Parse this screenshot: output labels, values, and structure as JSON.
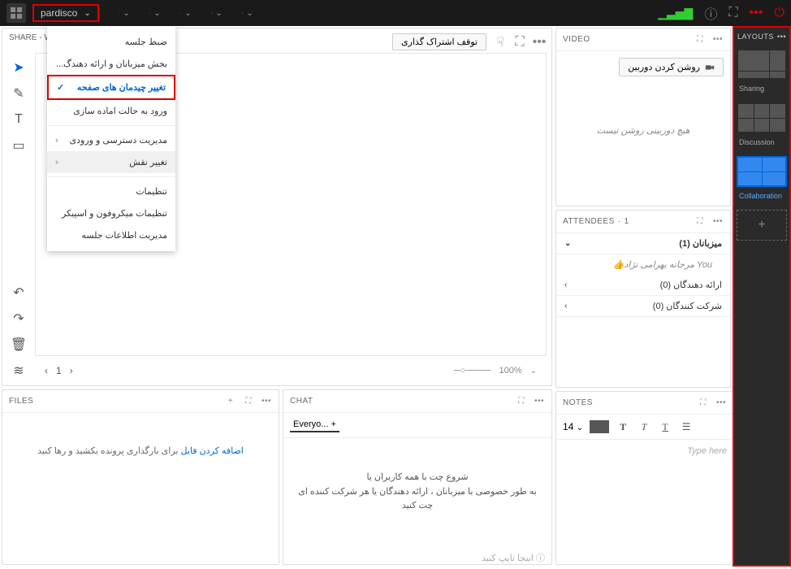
{
  "topbar": {
    "meeting_name": "pardisco",
    "icons": [
      "grid",
      "speaker",
      "mic",
      "camera",
      "thumbs-up"
    ]
  },
  "menu": {
    "items": [
      {
        "label": "ضبط جلسه"
      },
      {
        "label": "بخش میزبانان و ارائه دهندگ..."
      },
      {
        "label": "تغییر چیدمان های صفحه",
        "selected": true
      },
      {
        "label": "ورود به حالت اماده سازی"
      },
      {
        "label": "مدیریت دسترسی و ورودی",
        "submenu": true
      },
      {
        "label": "تغییر نقش",
        "submenu": true,
        "hover": true
      },
      {
        "label": "تنظیمات"
      },
      {
        "label": "تنظیمات میکروفون و اسپیکر"
      },
      {
        "label": "مدیریت اطلاعات جلسه"
      }
    ]
  },
  "share": {
    "title": "SHARE - W",
    "stop_button": "توقف اشتراک گذاری",
    "page": "1",
    "zoom": "100%"
  },
  "video": {
    "title": "VIDEO",
    "camera_btn": "روشن کردن دوربین",
    "empty": "هیچ دوربینی روشن نیست"
  },
  "attendees": {
    "title": "ATTENDEES",
    "count": "1",
    "groups": {
      "hosts": {
        "label": "میزبانان (1)",
        "expanded": true
      },
      "presenters": {
        "label": "ارائه دهندگان (0)"
      },
      "participants": {
        "label": "شرکت کنندگان (0)"
      }
    },
    "user": {
      "name": "مرجانه بهرامی نژاد",
      "you": "You"
    }
  },
  "files": {
    "title": "FILES",
    "link": "اضافه کردن فایل",
    "hint": " برای بارگذاری پرونده بکشید و رها کنید"
  },
  "chat": {
    "title": "CHAT",
    "tab": "Everyo...",
    "line1": "شروع چت با همه کاربران یا",
    "line2": "به طور خصوصی با میزبانان ، ارائه دهندگان یا هر شرکت کننده ای چت کنید",
    "placeholder": "اینجا تایپ کنید"
  },
  "notes": {
    "title": "NOTES",
    "font_size": "14",
    "placeholder": "Type here"
  },
  "layouts": {
    "title": "LAYOUTS",
    "items": [
      {
        "label": "Sharing"
      },
      {
        "label": "Discussion"
      },
      {
        "label": "Collaboration",
        "selected": true
      }
    ]
  }
}
